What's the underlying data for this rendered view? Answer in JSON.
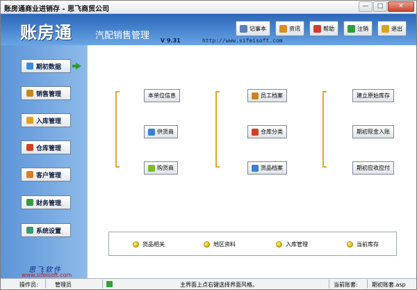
{
  "window": {
    "title": "账房通商业进销存 - 思飞商贸公司",
    "buttons": {
      "minimize": "—",
      "maximize": "□",
      "close": "✕"
    }
  },
  "header": {
    "logo_text": "账房通",
    "subtitle": "汽配销售管理",
    "version": "V 9.31",
    "website": "http://www.sifeisoft.com",
    "toolbar": [
      {
        "label": "记事本",
        "icon": "notepad-icon",
        "color": "#5b7fb7"
      },
      {
        "label": "资讯",
        "icon": "news-icon",
        "color": "#d98f1f"
      },
      {
        "label": "帮助",
        "icon": "help-icon",
        "color": "#d23b2b"
      },
      {
        "label": "注销",
        "icon": "logout-icon",
        "color": "#2f9c3e"
      },
      {
        "label": "退出",
        "icon": "exit-icon",
        "color": "#d9a21f"
      }
    ]
  },
  "sidebar": {
    "items": [
      {
        "label": "期初数据",
        "icon": "initial-data-icon",
        "color": "#3a8cd9",
        "active": true
      },
      {
        "label": "销售管理",
        "icon": "sales-icon",
        "color": "#c9861f"
      },
      {
        "label": "入库管理",
        "icon": "stock-in-icon",
        "color": "#e2a11c"
      },
      {
        "label": "仓库管理",
        "icon": "warehouse-icon",
        "color": "#d0401f"
      },
      {
        "label": "客户管理",
        "icon": "customer-icon",
        "color": "#e07a1c"
      },
      {
        "label": "财务管理",
        "icon": "finance-icon",
        "color": "#2f9c3e"
      },
      {
        "label": "系统设置",
        "icon": "settings-icon",
        "color": "#3a9a6a"
      }
    ],
    "brand_cn": "思飞软件",
    "brand_url": "www.sifeisoft.com"
  },
  "main": {
    "col1": [
      {
        "label": "本单位信息",
        "icon": null
      },
      {
        "label": "供货商",
        "icon": "supplier-icon",
        "color": "#3a7fd0"
      },
      {
        "label": "购货商",
        "icon": "buyer-icon",
        "color": "#7dbb2a"
      }
    ],
    "col2": [
      {
        "label": "员工档案",
        "icon": "employee-icon",
        "color": "#c9861f"
      },
      {
        "label": "仓库分类",
        "icon": "category-icon",
        "color": "#d0401f"
      },
      {
        "label": "货品档案",
        "icon": "goods-icon",
        "color": "#3a7fd0"
      }
    ],
    "col3": [
      {
        "label": "建立原始库存",
        "icon": null
      },
      {
        "label": "期初现金入账",
        "icon": null
      },
      {
        "label": "期初应收应付",
        "icon": null
      }
    ],
    "bottom": [
      "货品相关",
      "地区资料",
      "入库管理",
      "当前库存"
    ]
  },
  "status": {
    "operator_label": "操作员:",
    "operator": "管理员",
    "hint": "主界面上点右键选择界面风格。",
    "account_label": "当前账套:",
    "account": "期初账套.asp"
  }
}
